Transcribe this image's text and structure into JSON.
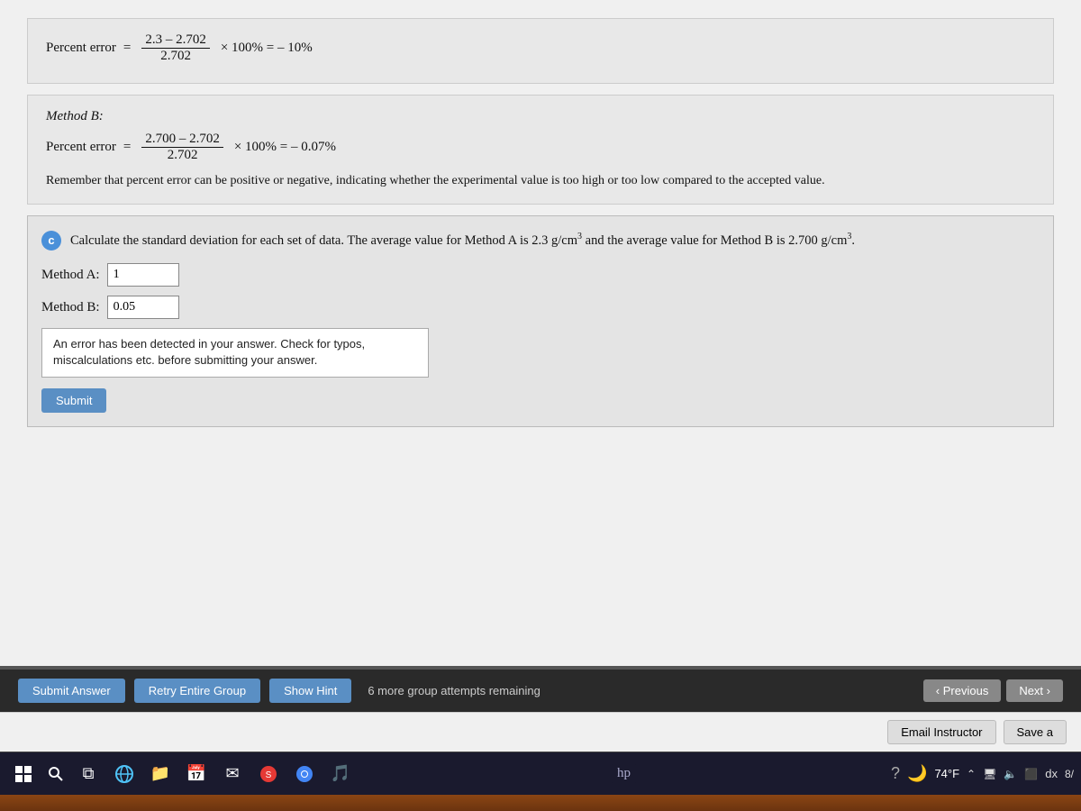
{
  "page": {
    "method_b_label": "Method B:",
    "percent_error_label": "Percent error",
    "equals": "=",
    "method_b_numerator": "2.700 – 2.702",
    "method_b_denominator": "2.702",
    "method_b_result": "× 100% = – 0.07%",
    "method_a_numerator": "2.3 – 2.702",
    "method_a_denominator": "2.702",
    "method_a_result": "× 100% = – 10%",
    "remember_text": "Remember that percent error can be positive or negative, indicating whether the experimental value is too high or too low compared to the accepted value.",
    "part_c_circle": "c",
    "part_c_question": "Calculate the standard deviation for each set of data. The average value for Method A is 2.3 g/cm³ and the average value for Method B is 2.700 g/cm³.",
    "method_a_input_label": "Method A:",
    "method_a_input_value": "1",
    "method_b_input_label": "Method B:",
    "method_b_input_value": "0.05",
    "error_message": "An error has been detected in your answer. Check for typos, miscalculations etc. before submitting your answer.",
    "submit_label": "Submit",
    "submit_answer_label": "Submit Answer",
    "retry_group_label": "Retry Entire Group",
    "show_hint_label": "Show Hint",
    "attempts_text": "6 more group attempts remaining",
    "previous_label": "Previous",
    "next_label": "Next",
    "email_instructor_label": "Email Instructor",
    "save_label": "Save a",
    "temperature": "74°F",
    "time": "8/"
  }
}
